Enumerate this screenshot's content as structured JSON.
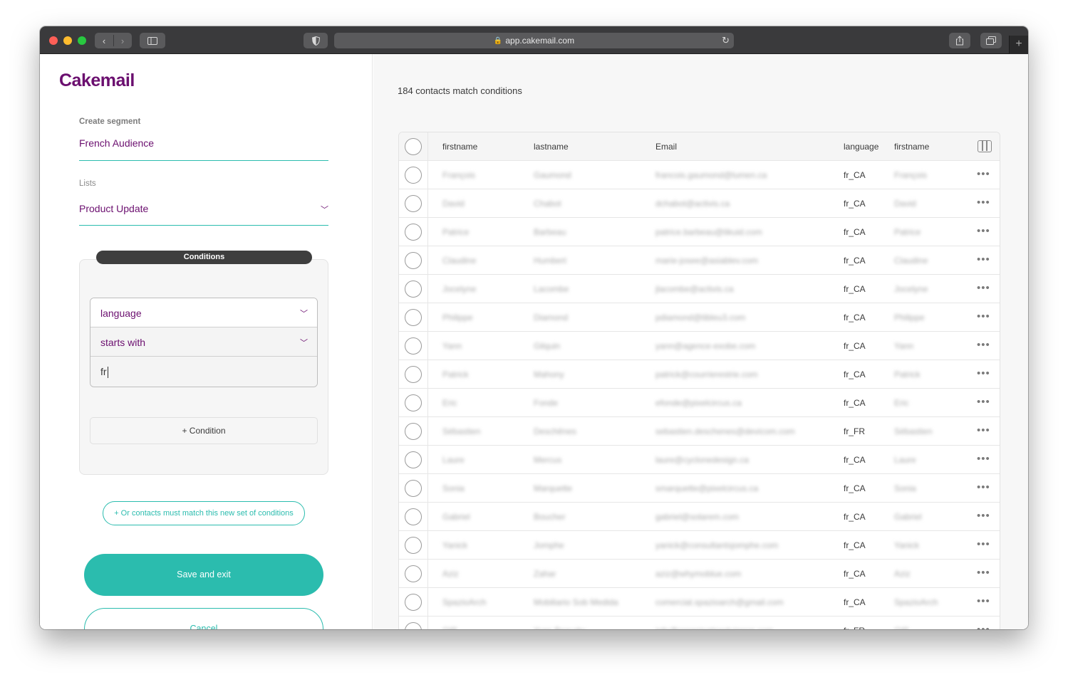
{
  "browser": {
    "url": "app.cakemail.com"
  },
  "sidebar": {
    "logo": "Cakemail",
    "segment_label": "Create segment",
    "segment_name": "French Audience",
    "lists_label": "Lists",
    "list_value": "Product Update",
    "conditions_title": "Conditions",
    "condition": {
      "field": "language",
      "operator": "starts with",
      "value": "fr"
    },
    "add_condition_label": "+ Condition",
    "or_conditions_label": "+ Or contacts must match this new set of conditions",
    "save_label": "Save and exit",
    "cancel_label": "Cancel"
  },
  "results": {
    "match_count": "184 contacts match conditions",
    "columns": [
      "firstname",
      "lastname",
      "Email",
      "language",
      "firstname"
    ],
    "rows": [
      {
        "firstname": "François",
        "lastname": "Gaumond",
        "email": "francois.gaumond@lumen.ca",
        "language": "fr_CA"
      },
      {
        "firstname": "David",
        "lastname": "Chabot",
        "email": "dchabot@activis.ca",
        "language": "fr_CA"
      },
      {
        "firstname": "Patrice",
        "lastname": "Barbeau",
        "email": "patrice.barbeau@tikuid.com",
        "language": "fr_CA"
      },
      {
        "firstname": "Claudine",
        "lastname": "Humbert",
        "email": "marie-josee@asiablev.com",
        "language": "fr_CA"
      },
      {
        "firstname": "Jocelyne",
        "lastname": "Lacombe",
        "email": "jlacombe@activis.ca",
        "language": "fr_CA"
      },
      {
        "firstname": "Philippe",
        "lastname": "Diamond",
        "email": "pdiamond@tibleu3.com",
        "language": "fr_CA"
      },
      {
        "firstname": "Yann",
        "lastname": "Gilquin",
        "email": "yann@agence-exobe.com",
        "language": "fr_CA"
      },
      {
        "firstname": "Patrick",
        "lastname": "Mahony",
        "email": "patrick@courrierestrie.com",
        "language": "fr_CA"
      },
      {
        "firstname": "Eric",
        "lastname": "Fonde",
        "email": "efonde@pixelcircus.ca",
        "language": "fr_CA"
      },
      {
        "firstname": "Sébastien",
        "lastname": "Deschênes",
        "email": "sebastien.deschenes@devicom.com",
        "language": "fr_FR"
      },
      {
        "firstname": "Laure",
        "lastname": "Mercus",
        "email": "laure@cyclonedesign.ca",
        "language": "fr_CA"
      },
      {
        "firstname": "Sonia",
        "lastname": "Marquette",
        "email": "smarquette@pixelcircus.ca",
        "language": "fr_CA"
      },
      {
        "firstname": "Gabriel",
        "lastname": "Boucher",
        "email": "gabriel@solarem.com",
        "language": "fr_CA"
      },
      {
        "firstname": "Yanick",
        "lastname": "Jomphe",
        "email": "yanick@consultantsjomphe.com",
        "language": "fr_CA"
      },
      {
        "firstname": "Aziz",
        "lastname": "Zahar",
        "email": "aziz@whymoblue.com",
        "language": "fr_CA"
      },
      {
        "firstname": "SpazioArch",
        "lastname": "Mobiliario Sob Medida",
        "email": "comercial.spazioarch@gmail.com",
        "language": "fr_CA"
      },
      {
        "firstname": "OIP",
        "lastname": "Yves Beaudry",
        "email": "info@organisationdujapon.com",
        "language": "fr_FR"
      }
    ]
  },
  "colors": {
    "brand": "#6b0f6f",
    "accent": "#2bbcae"
  }
}
